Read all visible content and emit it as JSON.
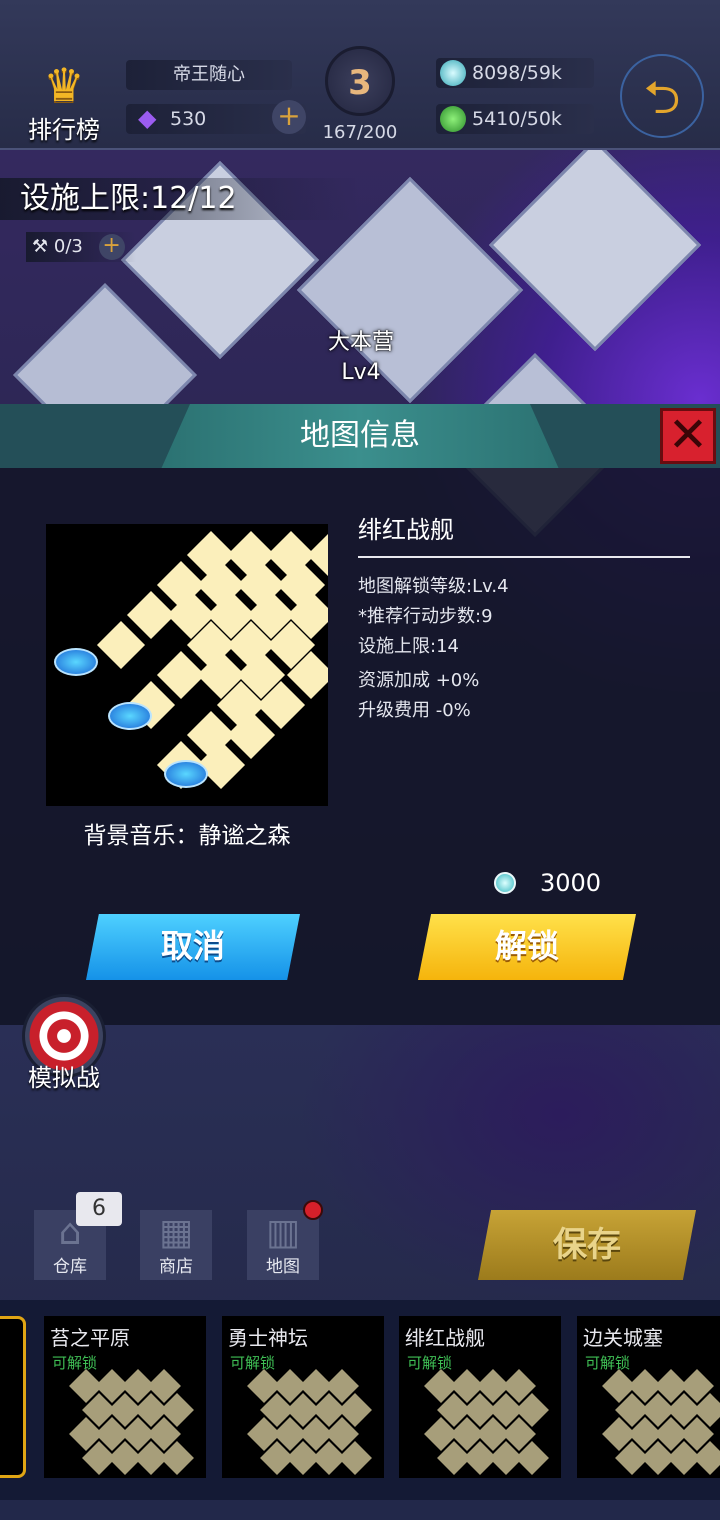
{
  "topbar": {
    "rank_label": "排行榜",
    "username": "帝王随心",
    "gems": "530",
    "trophy_level": "3",
    "trophy_progress": "167/200",
    "resource1": "8098/59k",
    "resource2": "5410/50k",
    "icons": {
      "rank": "crown-icon",
      "gem": "gem-icon",
      "back": "back-arrow-icon"
    }
  },
  "field": {
    "facility_cap": "设施上限:12/12",
    "tools": "0/3",
    "camp_name": "大本营",
    "camp_level": "Lv4"
  },
  "modal": {
    "title": "地图信息",
    "map_name": "绯红战舰",
    "info": [
      "地图解锁等级:Lv.4",
      "*推荐行动步数:9",
      "设施上限:14",
      "资源加成 +0%",
      "升级费用 -0%"
    ],
    "bgm": "背景音乐：静谧之森",
    "cost": "3000",
    "cancel_label": "取消",
    "unlock_label": "解锁"
  },
  "bottom": {
    "sim_label": "模拟战",
    "nav": [
      {
        "label": "仓库",
        "icon": "warehouse-icon"
      },
      {
        "label": "商店",
        "icon": "shop-icon"
      },
      {
        "label": "地图",
        "icon": "map-icon"
      }
    ],
    "warehouse_badge": "6",
    "save_label": "保存"
  },
  "maps": [
    {
      "name": "苔之平原",
      "status": "可解锁"
    },
    {
      "name": "勇士神坛",
      "status": "可解锁"
    },
    {
      "name": "绯红战舰",
      "status": "可解锁"
    },
    {
      "name": "边关城塞",
      "status": "可解锁"
    }
  ],
  "colors": {
    "accent_teal": "#3b8f8d",
    "cancel_blue": "#1592e8",
    "unlock_yellow": "#f5b40c",
    "close_red": "#d8212e",
    "status_green": "#3fbf55"
  }
}
